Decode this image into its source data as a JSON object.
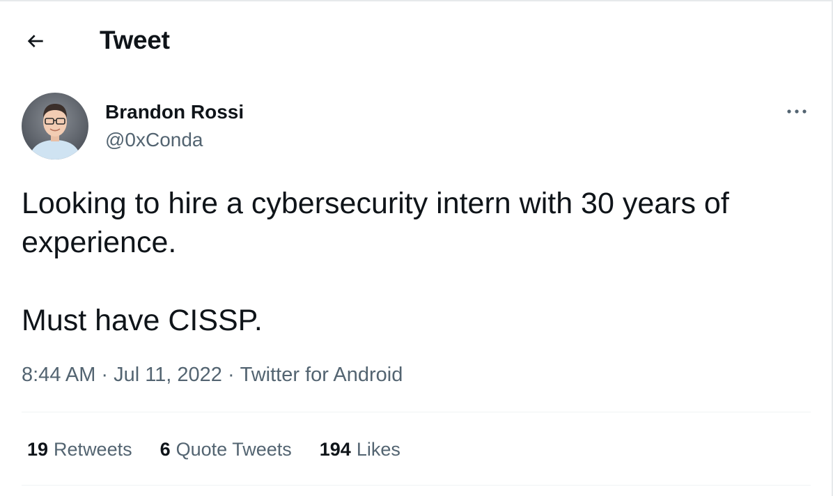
{
  "header": {
    "back_icon": "arrow-left-icon",
    "title": "Tweet"
  },
  "author": {
    "name": "Brandon Rossi",
    "handle": "@0xConda",
    "avatar_icon": "avatar-photo",
    "more_icon": "more-horizontal-icon"
  },
  "tweet": {
    "line1": "Looking to hire a cybersecurity intern with 30 years of experience.",
    "line2": "Must have CISSP.",
    "time": "8:44 AM",
    "date": "Jul 11, 2022",
    "source": "Twitter for Android",
    "separator": "·"
  },
  "stats": {
    "retweets_count": "19",
    "retweets_label": "Retweets",
    "quotes_count": "6",
    "quotes_label": "Quote Tweets",
    "likes_count": "194",
    "likes_label": "Likes"
  },
  "colors": {
    "text_primary": "#0f1419",
    "text_secondary": "#536471",
    "divider": "#eff3f4"
  }
}
